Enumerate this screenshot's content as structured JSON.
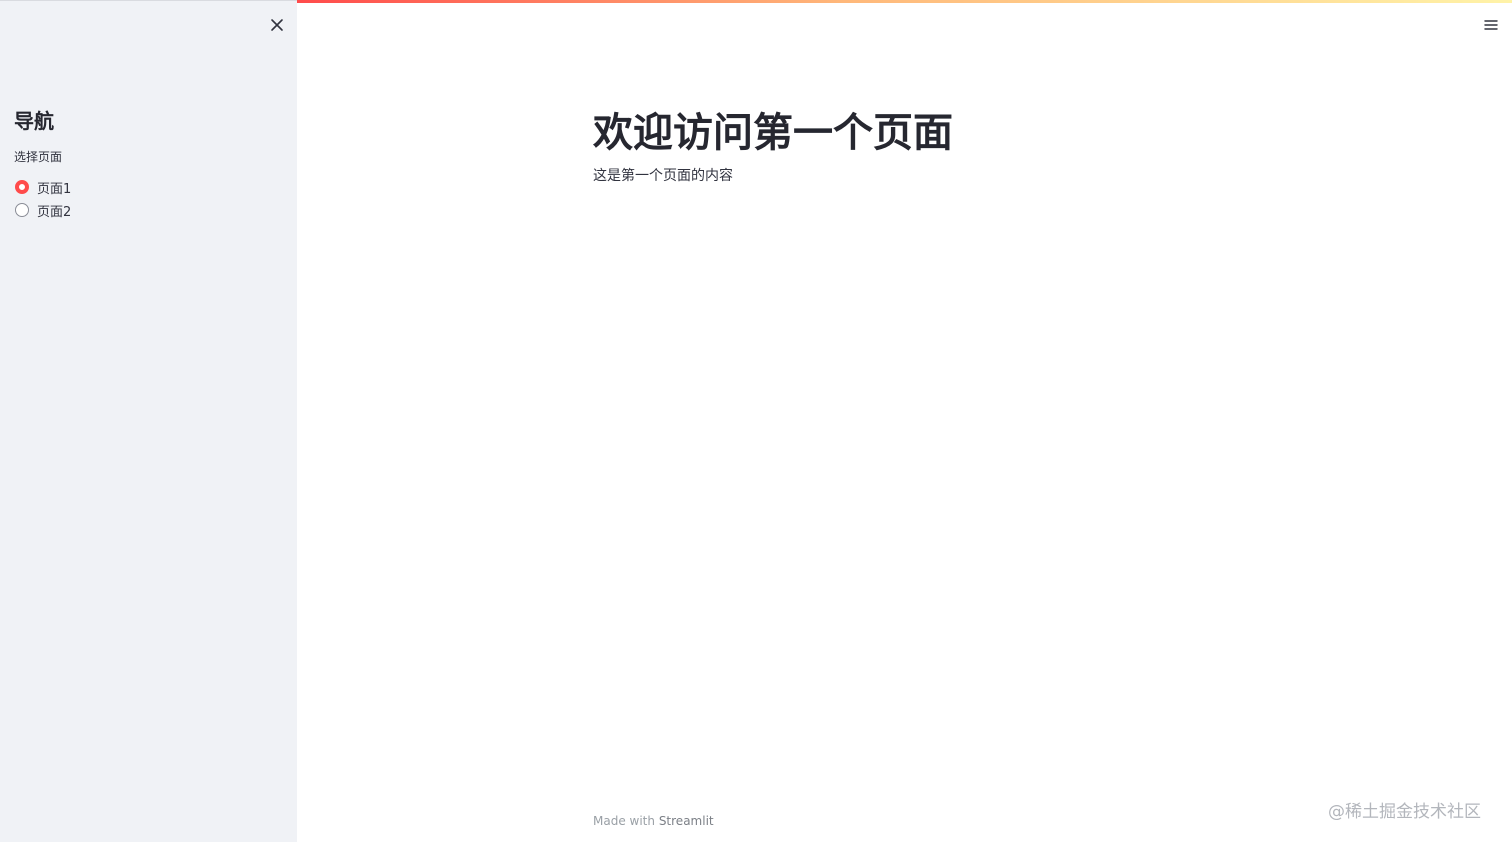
{
  "sidebar": {
    "title": "导航",
    "radio_label": "选择页面",
    "options": [
      {
        "label": "页面1",
        "selected": true
      },
      {
        "label": "页面2",
        "selected": false
      }
    ]
  },
  "main": {
    "title": "欢迎访问第一个页面",
    "content": "这是第一个页面的内容"
  },
  "footer": {
    "prefix": "Made with",
    "brand": "Streamlit"
  },
  "watermark": "@稀土掘金技术社区",
  "colors": {
    "accent": "#ff4b4b",
    "sidebar_bg": "#f0f2f6",
    "text": "#31333f"
  },
  "icons": {
    "close": "close-icon",
    "menu": "hamburger-menu-icon"
  }
}
